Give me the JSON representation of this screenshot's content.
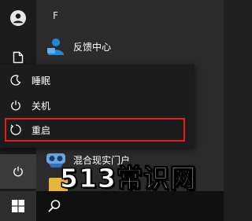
{
  "start_menu": {
    "letter_header": "F",
    "apps": [
      {
        "label": "反馈中心",
        "icon": "feedback-hub-icon"
      },
      {
        "label": "混合现实门户",
        "icon": "mixed-reality-portal-icon"
      }
    ]
  },
  "power_menu": {
    "items": [
      {
        "label": "睡眠",
        "icon": "moon-icon"
      },
      {
        "label": "关机",
        "icon": "power-icon"
      },
      {
        "label": "重启",
        "icon": "restart-icon"
      }
    ],
    "highlighted_item": "重启",
    "highlight_color": "#e02020"
  },
  "rail": {
    "icons": [
      "user-icon",
      "document-icon",
      "power-icon"
    ]
  },
  "taskbar": {
    "icons": [
      "windows-start-icon",
      "search-icon"
    ]
  },
  "watermark": {
    "text": "513常识网"
  }
}
